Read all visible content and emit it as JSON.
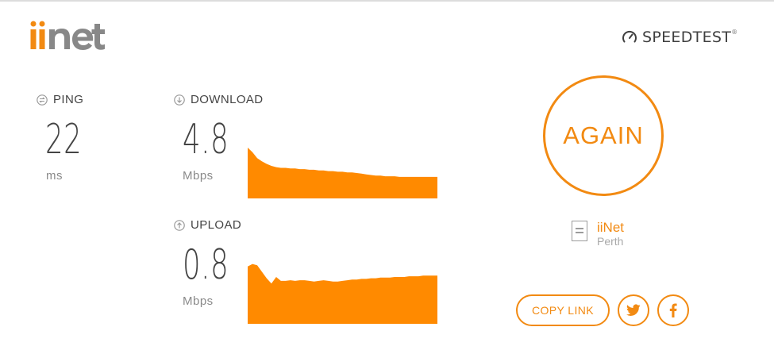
{
  "brand": {
    "logo_text": "iinet",
    "speedtest_label": "SPEEDTEST",
    "trademark": "®"
  },
  "ping": {
    "label": "PING",
    "value": "22",
    "unit": "ms"
  },
  "download": {
    "label": "DOWNLOAD",
    "value": "4.8",
    "unit": "Mbps",
    "graph": [
      0.78,
      0.71,
      0.62,
      0.57,
      0.53,
      0.5,
      0.48,
      0.47,
      0.47,
      0.46,
      0.46,
      0.45,
      0.45,
      0.44,
      0.44,
      0.43,
      0.43,
      0.42,
      0.42,
      0.41,
      0.41,
      0.4,
      0.4,
      0.39,
      0.38,
      0.37,
      0.36,
      0.35,
      0.35,
      0.34,
      0.34,
      0.34,
      0.33,
      0.33,
      0.33,
      0.33,
      0.33,
      0.33,
      0.33,
      0.33,
      0.33
    ]
  },
  "upload": {
    "label": "UPLOAD",
    "value": "0.8",
    "unit": "Mbps",
    "graph": [
      0.88,
      0.92,
      0.9,
      0.8,
      0.7,
      0.62,
      0.72,
      0.66,
      0.66,
      0.67,
      0.66,
      0.67,
      0.67,
      0.66,
      0.65,
      0.66,
      0.67,
      0.66,
      0.65,
      0.65,
      0.66,
      0.67,
      0.68,
      0.68,
      0.69,
      0.69,
      0.7,
      0.7,
      0.71,
      0.71,
      0.71,
      0.72,
      0.72,
      0.72,
      0.73,
      0.73,
      0.73,
      0.74,
      0.74,
      0.74,
      0.74
    ]
  },
  "again_button": "AGAIN",
  "server": {
    "name": "iiNet",
    "location": "Perth"
  },
  "share": {
    "copy_link": "COPY LINK",
    "twitter_icon": "twitter-icon",
    "facebook_icon": "facebook-icon"
  },
  "colors": {
    "accent": "#f28a12",
    "graph_fill": "#ff8a00",
    "text": "#444444",
    "muted": "#8a8a8a"
  }
}
